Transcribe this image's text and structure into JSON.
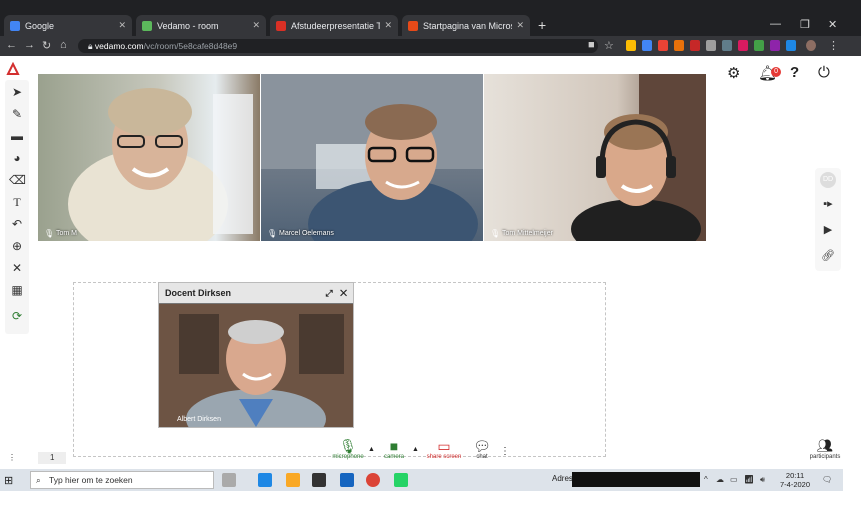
{
  "browser": {
    "tabs": [
      {
        "label": "Google",
        "color": "#4285f4"
      },
      {
        "label": "Vedamo - room",
        "color": "#5cb85c"
      },
      {
        "label": "Afstudeerpresentatie Tom M",
        "color": "#d93025"
      },
      {
        "label": "Startpagina van Microsoft Office",
        "color": "#e64a19"
      }
    ],
    "new_tab": "+",
    "url_host": "vedamo.com",
    "url_path": "/vc/room/5e8cafe8d48e9"
  },
  "app": {
    "videos": [
      {
        "name": "Tom M"
      },
      {
        "name": "Marcel Oelemans"
      },
      {
        "name": "Tom Mittelmeijer"
      }
    ],
    "popup": {
      "title": "Docent Dirksen",
      "name": "Albert Dirksen"
    },
    "controls": [
      {
        "label": "microphone"
      },
      {
        "label": "camera"
      },
      {
        "label": "share screen"
      },
      {
        "label": "chat"
      }
    ],
    "participants_label": "participants",
    "page_number": "1",
    "notification_count": "0"
  },
  "taskbar": {
    "search_placeholder": "Typ hier om te zoeken",
    "address_label": "Adres",
    "time": "20:11",
    "date": "7-4-2020"
  }
}
